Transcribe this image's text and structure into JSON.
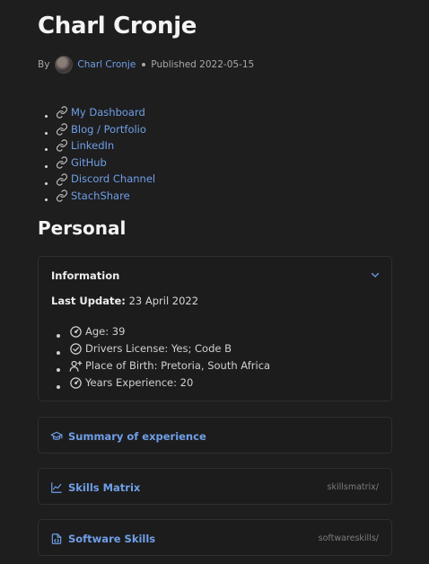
{
  "header": {
    "title": "Charl Cronje",
    "by_label": "By",
    "author": "Charl Cronje",
    "published": "Published 2022-05-15"
  },
  "links": [
    {
      "label": "My Dashboard",
      "icon": "link-icon"
    },
    {
      "label": "Blog / Portfolio",
      "icon": "link-icon"
    },
    {
      "label": "LinkedIn",
      "icon": "link-icon"
    },
    {
      "label": "GitHub",
      "icon": "link-icon"
    },
    {
      "label": "Discord Channel",
      "icon": "link-icon"
    },
    {
      "label": "StachShare",
      "icon": "link-icon"
    }
  ],
  "section": {
    "heading": "Personal"
  },
  "info_card": {
    "title": "Information",
    "last_update_label": "Last Update:",
    "last_update_value": "23 April 2022",
    "facts": [
      {
        "text": "Age: 39",
        "icon": "gauge-icon"
      },
      {
        "text": "Drivers License: Yes; Code B",
        "icon": "check-circle-icon"
      },
      {
        "text": "Place of Birth: Pretoria, South Africa",
        "icon": "user-plus-icon"
      },
      {
        "text": "Years Experience: 20",
        "icon": "gauge-icon"
      }
    ]
  },
  "collapsed_cards": [
    {
      "label": "Summary of experience",
      "icon": "graduation-cap-icon",
      "path": ""
    },
    {
      "label": "Skills Matrix",
      "icon": "line-chart-icon",
      "path": "skillsmatrix/"
    },
    {
      "label": "Software Skills",
      "icon": "code-file-icon",
      "path": "softwareskills/"
    }
  ],
  "colors": {
    "background": "#1e1e1f",
    "link": "#6f9fe6",
    "text": "#d6d6d6",
    "border": "#2f2f31"
  }
}
